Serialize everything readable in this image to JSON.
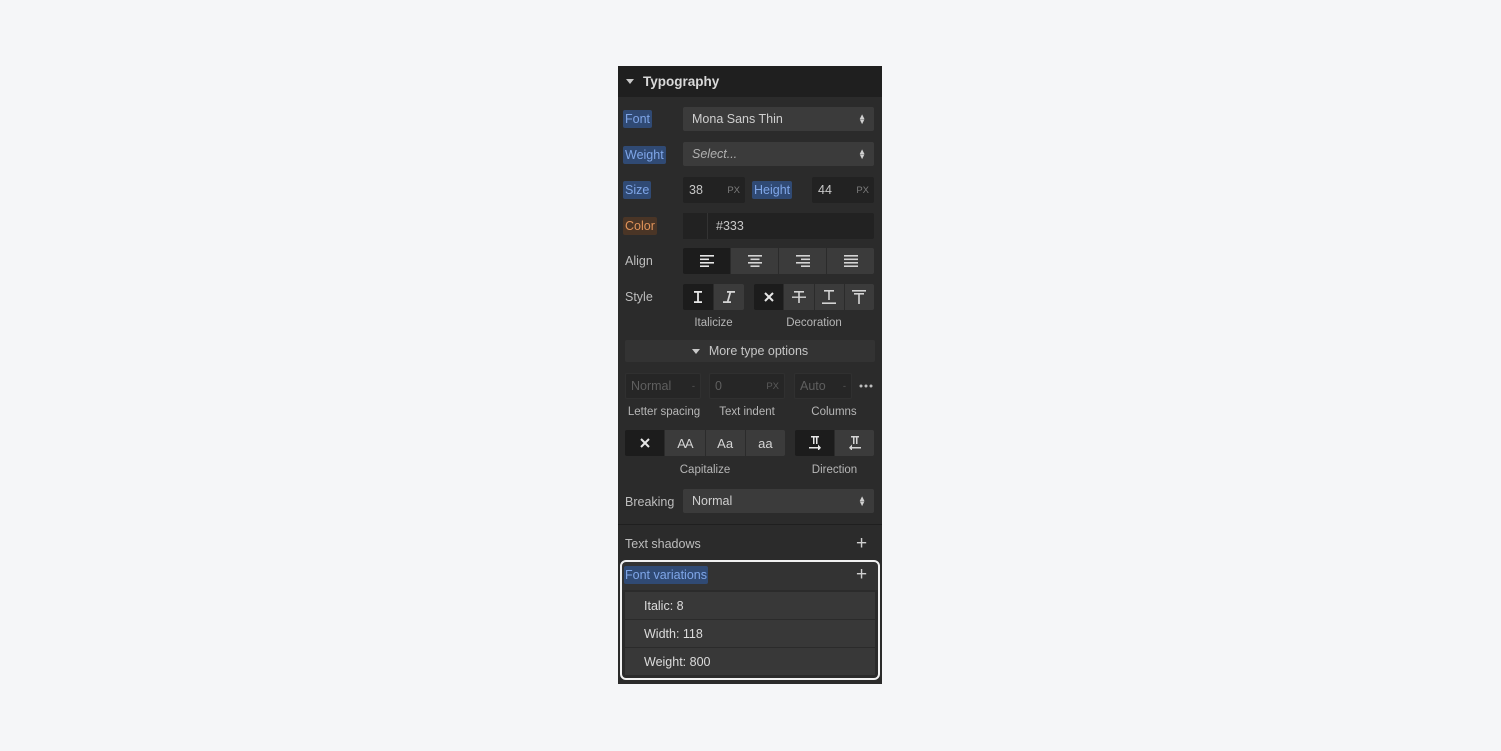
{
  "panel": {
    "title": "Typography",
    "font": {
      "label": "Font",
      "value": "Mona Sans Thin"
    },
    "weight": {
      "label": "Weight",
      "placeholder": "Select..."
    },
    "size": {
      "label": "Size",
      "value": "38",
      "unit": "PX"
    },
    "height": {
      "label": "Height",
      "value": "44",
      "unit": "PX"
    },
    "color": {
      "label": "Color",
      "value": "#333",
      "swatch": "#222222"
    },
    "align": {
      "label": "Align",
      "options": [
        "align-left-icon",
        "align-center-icon",
        "align-right-icon",
        "align-justify-icon"
      ],
      "selected": 0
    },
    "style": {
      "label": "Style",
      "italicize_caption": "Italicize",
      "decoration_caption": "Decoration"
    },
    "more_type_options": "More type options",
    "letter_spacing": {
      "value": "Normal",
      "caption": "Letter spacing"
    },
    "text_indent": {
      "value": "0",
      "unit": "PX",
      "caption": "Text indent"
    },
    "columns": {
      "value": "Auto",
      "caption": "Columns"
    },
    "capitalize": {
      "caption": "Capitalize",
      "options": [
        "none",
        "AA",
        "Aa",
        "aa"
      ]
    },
    "direction": {
      "caption": "Direction"
    },
    "breaking": {
      "label": "Breaking",
      "value": "Normal"
    },
    "text_shadows": {
      "label": "Text shadows"
    },
    "font_variations": {
      "label": "Font variations",
      "items": [
        "Italic: 8",
        "Width: 118",
        "Weight: 800"
      ]
    }
  },
  "colors": {
    "panel_bg": "#2b2b2b",
    "header_bg": "#1f1f1f",
    "accent_blue": "#7fa6e8",
    "accent_orange": "#e0935a",
    "highlight_border": "#f1f1f1"
  }
}
